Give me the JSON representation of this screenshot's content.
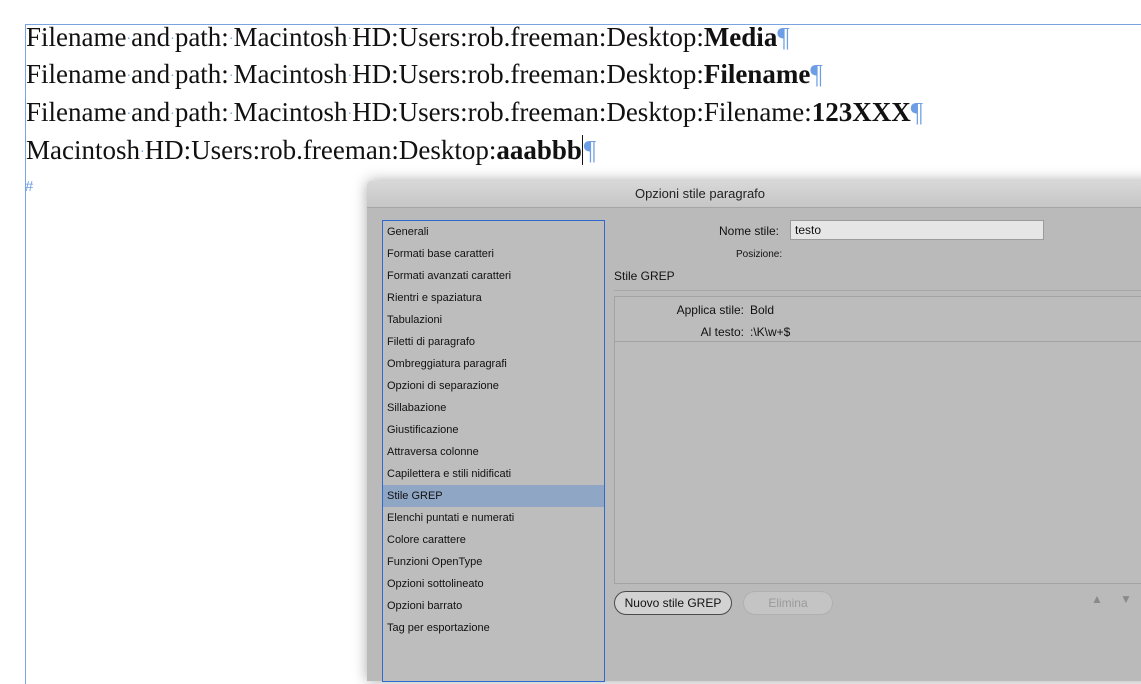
{
  "document": {
    "lines": [
      {
        "prefix": "Filename",
        "dots": [
          "and",
          "path:",
          "Macintosh",
          "HD:Users:rob.freeman:Desktop:"
        ],
        "bold": "Media"
      },
      {
        "prefix": "Filename",
        "dots": [
          "and",
          "path:",
          "Macintosh",
          "HD:Users:rob.freeman:Desktop:"
        ],
        "bold": "Filename"
      },
      {
        "prefix": "Filename",
        "dots": [
          "and",
          "path:",
          "Macintosh",
          "HD:Users:rob.freeman:Desktop:Filename:"
        ],
        "bold": "123XXX"
      },
      {
        "prefix": "Macintosh",
        "dots": [
          "HD:Users:rob.freeman:Desktop:"
        ],
        "bold": "aaabbb"
      }
    ],
    "pilcrow": "¶",
    "end_marker": "#"
  },
  "dialog": {
    "title": "Opzioni stile paragrafo",
    "categories": [
      "Generali",
      "Formati base caratteri",
      "Formati avanzati caratteri",
      "Rientri e spaziatura",
      "Tabulazioni",
      "Filetti di paragrafo",
      "Ombreggiatura paragrafi",
      "Opzioni di separazione",
      "Sillabazione",
      "Giustificazione",
      "Attraversa colonne",
      "Capilettera e stili nidificati",
      "Stile GREP",
      "Elenchi puntati e numerati",
      "Colore carattere",
      "Funzioni OpenType",
      "Opzioni sottolineato",
      "Opzioni barrato",
      "Tag per esportazione"
    ],
    "selected_category": "Stile GREP",
    "style_name_label": "Nome stile:",
    "style_name_value": "testo",
    "position_label": "Posizione:",
    "section_title": "Stile GREP",
    "rule": {
      "apply_label": "Applica stile:",
      "apply_value": "Bold",
      "text_label": "Al testo:",
      "text_value": ":\\K\\w+$"
    },
    "new_button": "Nuovo stile GREP",
    "delete_button": "Elimina",
    "up_arrow": "▲",
    "down_arrow": "▼"
  },
  "colors": {
    "frame": "#7aa3e0",
    "selection": "#8fa6c5",
    "dialog_bg": "#bababa",
    "hidden_chars": "#6d9de5"
  }
}
